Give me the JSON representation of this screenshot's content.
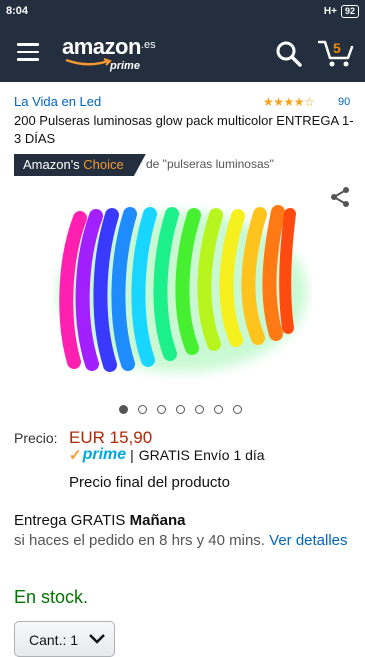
{
  "status_bar": {
    "time": "8:04",
    "network": "H+",
    "battery": "92"
  },
  "header": {
    "logo_word": "amazon",
    "logo_domain": ".es",
    "logo_prime": "prime",
    "cart_count": "5",
    "icons": [
      "menu-icon",
      "search-icon",
      "cart-icon"
    ]
  },
  "product": {
    "seller": "La Vida en Led",
    "rating_stars": "★★★★☆",
    "rating_value": 4.2,
    "review_count": "90",
    "title": "200 Pulseras luminosas glow pack multicolor ENTREGA 1-3 DÍAS",
    "choice_prefix": "Amazon's ",
    "choice_word": "Choice",
    "choice_context": "de \"pulseras luminosas\"",
    "image_count": 7,
    "active_image": 0
  },
  "price": {
    "label": "Precio:",
    "value": "EUR 15,90",
    "prime_check": "✓",
    "prime_label": "prime",
    "separator": "|",
    "shipping": "GRATIS Envío 1 día",
    "final_note": "Precio final del producto"
  },
  "delivery": {
    "prefix": "Entrega GRATIS ",
    "day": "Mañana",
    "condition": "si haces el pedido en 8 hrs y 40 mins. ",
    "details_link": "Ver detalles"
  },
  "stock": "En stock.",
  "quantity": {
    "label": "Cant.:",
    "value": "1"
  },
  "colors": {
    "header_bg": "#232f3e",
    "link": "#0066c0",
    "price": "#b12704",
    "stock": "#007600",
    "choice_accent": "#f69931",
    "prime_blue": "#00a8e1"
  }
}
